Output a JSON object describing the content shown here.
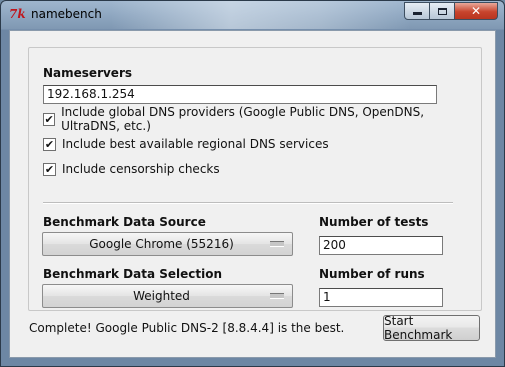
{
  "window": {
    "title": "namebench",
    "icon": "tk-feather-icon"
  },
  "nameservers": {
    "label": "Nameservers",
    "value": "192.168.1.254"
  },
  "checkboxes": [
    {
      "label": "Include global DNS providers (Google Public DNS, OpenDNS, UltraDNS, etc.)",
      "checked": true
    },
    {
      "label": "Include best available regional DNS services",
      "checked": true
    },
    {
      "label": "Include censorship checks",
      "checked": true
    }
  ],
  "benchmark_source": {
    "label": "Benchmark Data Source",
    "selected": "Google Chrome (55216)"
  },
  "benchmark_selection": {
    "label": "Benchmark Data Selection",
    "selected": "Weighted"
  },
  "num_tests": {
    "label": "Number of tests",
    "value": "200"
  },
  "num_runs": {
    "label": "Number of runs",
    "value": "1"
  },
  "status": "Complete! Google Public DNS-2 [8.8.4.4] is the best.",
  "start_button": "Start Benchmark",
  "checkmark": "✔"
}
